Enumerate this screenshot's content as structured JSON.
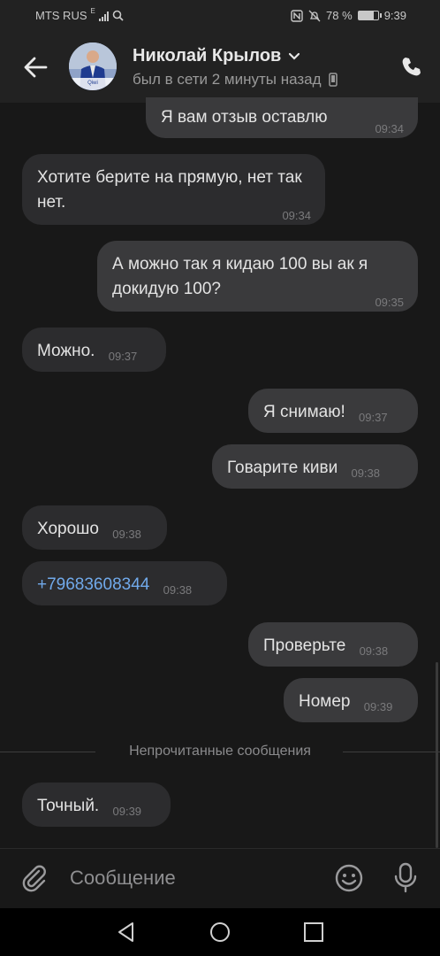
{
  "statusbar": {
    "carrier": "MTS RUS",
    "net_type": "E",
    "battery": "78 %",
    "battery_level": 0.78,
    "time": "9:39"
  },
  "header": {
    "contact_name": "Николай Крылов",
    "last_seen": "был в сети 2 минуты назад",
    "avatar_label": "Qiwi"
  },
  "messages": [
    {
      "dir": "out",
      "text": "Я вам отзыв оставлю",
      "time": "09:34"
    },
    {
      "dir": "in",
      "text": "Хотите берите на прямую, нет так нет.",
      "time": "09:34"
    },
    {
      "dir": "out",
      "text": "А можно так я кидаю 100 вы ак я докидую 100?",
      "time": "09:35"
    },
    {
      "dir": "in",
      "text": "Можно.",
      "time": "09:37"
    },
    {
      "dir": "out",
      "text": "Я снимаю!",
      "time": "09:37"
    },
    {
      "dir": "out",
      "text": "Говарите киви",
      "time": "09:38"
    },
    {
      "dir": "in",
      "text": "Хорошо",
      "time": "09:38"
    },
    {
      "dir": "in",
      "text": "+79683608344",
      "time": "09:38"
    },
    {
      "dir": "out",
      "text": "Проверьте",
      "time": "09:38"
    },
    {
      "dir": "out",
      "text": "Номер",
      "time": "09:39"
    },
    {
      "dir": "in",
      "text": "Точный.",
      "time": "09:39"
    }
  ],
  "unread_divider": "Непрочитанные сообщения",
  "composer": {
    "placeholder": "Сообщение"
  },
  "colors": {
    "background": "#181818",
    "header": "#222222",
    "bubble_in": "#2c2c2e",
    "bubble_out": "#3a3a3c",
    "link": "#71aaeb"
  },
  "icons": [
    "back-arrow-icon",
    "chevron-down-icon",
    "phone-icon",
    "mobile-device-icon",
    "paperclip-icon",
    "emoji-icon",
    "microphone-icon",
    "nav-back-icon",
    "nav-home-icon",
    "nav-recents-icon"
  ]
}
